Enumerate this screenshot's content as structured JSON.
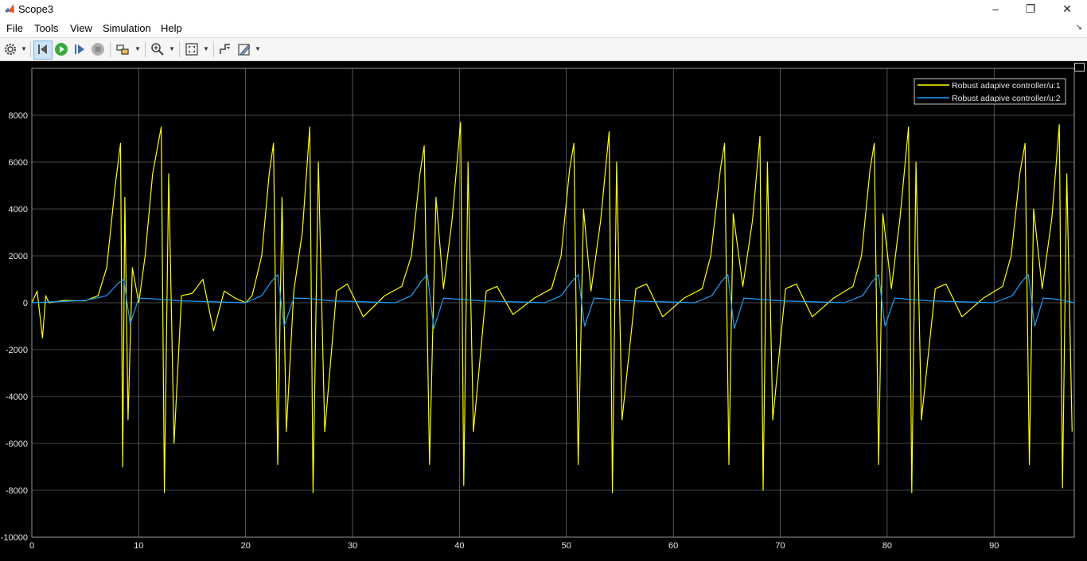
{
  "window": {
    "title": "Scope3",
    "minimize": "–",
    "maximize": "❐",
    "close": "✕"
  },
  "menu": {
    "items": [
      "File",
      "Tools",
      "View",
      "Simulation",
      "Help"
    ],
    "overflow_arrow": "↘"
  },
  "toolbar": {
    "icons": [
      "settings-icon",
      "step-back-icon",
      "run-icon",
      "step-forward-icon",
      "stop-icon",
      "highlight-icon",
      "zoom-icon",
      "autoscale-icon",
      "triggers-icon",
      "edit-icon"
    ]
  },
  "colors": {
    "series1": "#ffff00",
    "series2": "#1a9fff",
    "grid": "#8c8c8c",
    "background": "#000000"
  },
  "chart_data": {
    "type": "line",
    "title": "",
    "xlabel": "",
    "ylabel": "",
    "xlim": [
      0,
      97.5
    ],
    "ylim": [
      -10000,
      10000
    ],
    "x_ticks": [
      0,
      10,
      20,
      30,
      40,
      50,
      60,
      70,
      80,
      90
    ],
    "y_ticks": [
      -10000,
      -8000,
      -6000,
      -4000,
      -2000,
      0,
      2000,
      4000,
      6000,
      8000
    ],
    "grid": true,
    "legend_position": "top-right",
    "series": [
      {
        "name": "Robust adapive controller/u:1",
        "x": [
          0,
          0.5,
          1.0,
          1.3,
          1.6,
          3,
          5,
          6.2,
          7,
          7.8,
          8.3,
          8.5,
          8.7,
          9.0,
          9.4,
          10,
          10.6,
          11.3,
          12.1,
          12.4,
          12.8,
          13.3,
          14,
          15,
          16,
          17,
          18,
          19,
          20,
          20.6,
          21.5,
          22.2,
          22.6,
          23.0,
          23.4,
          23.8,
          24.5,
          25.3,
          26.0,
          26.3,
          26.8,
          27.4,
          28.5,
          29.5,
          31,
          33,
          34.6,
          35.5,
          36.3,
          36.7,
          37.2,
          37.8,
          38.5,
          39.3,
          40.1,
          40.4,
          40.8,
          41.3,
          42.5,
          43.5,
          45,
          47,
          48.6,
          49.5,
          50.3,
          50.7,
          51.1,
          51.6,
          52.3,
          53.2,
          54.0,
          54.3,
          54.7,
          55.2,
          56.5,
          57.5,
          59,
          61,
          62.7,
          63.5,
          64.4,
          64.8,
          65.2,
          65.6,
          66.5,
          67.4,
          68.1,
          68.4,
          68.8,
          69.3,
          70.5,
          71.5,
          73,
          75,
          76.8,
          77.6,
          78.4,
          78.8,
          79.2,
          79.6,
          80.4,
          81.2,
          82.0,
          82.3,
          82.7,
          83.2,
          84.5,
          85.5,
          87,
          89,
          90.8,
          91.6,
          92.4,
          92.9,
          93.3,
          93.7,
          94.5,
          95.4,
          96.1,
          96.4,
          96.8,
          97.3
        ],
        "y": [
          0,
          500,
          -1500,
          300,
          0,
          100,
          80,
          300,
          1500,
          5000,
          6800,
          -7000,
          4500,
          -5000,
          1500,
          0,
          2000,
          5500,
          7500,
          -8100,
          5500,
          -6000,
          300,
          400,
          1000,
          -1200,
          500,
          200,
          0,
          300,
          2000,
          5500,
          6800,
          -6900,
          4500,
          -5500,
          500,
          3000,
          7500,
          -8100,
          6000,
          -5500,
          500,
          800,
          -600,
          300,
          700,
          2000,
          5500,
          6700,
          -6900,
          4500,
          600,
          3500,
          7700,
          -7800,
          6000,
          -5500,
          500,
          700,
          -500,
          200,
          600,
          2000,
          5700,
          6800,
          -6900,
          4000,
          500,
          3500,
          7300,
          -8100,
          6000,
          -5000,
          600,
          800,
          -600,
          200,
          600,
          2000,
          5700,
          6800,
          -6900,
          3800,
          700,
          3500,
          7100,
          -8000,
          6000,
          -5000,
          600,
          800,
          -600,
          200,
          700,
          2000,
          5700,
          6800,
          -6900,
          3800,
          600,
          3600,
          7500,
          -8100,
          6000,
          -5000,
          600,
          800,
          -600,
          200,
          700,
          2000,
          5500,
          6800,
          -6900,
          4000,
          600,
          3600,
          7600,
          -7900,
          5500,
          -5500
        ]
      },
      {
        "name": "Robust adapive controller/u:2",
        "x": [
          0,
          5,
          7,
          8,
          8.6,
          9.2,
          10,
          12,
          14,
          20,
          21.5,
          22.4,
          23,
          23.6,
          24.5,
          26,
          28,
          34,
          35.5,
          36.4,
          37,
          37.6,
          38.5,
          40,
          42,
          48,
          49.5,
          50.5,
          51.1,
          51.7,
          52.6,
          54,
          56,
          62,
          63.6,
          64.5,
          65.1,
          65.7,
          66.6,
          68,
          70,
          76,
          77.7,
          78.6,
          79.2,
          79.8,
          80.7,
          82,
          84,
          90,
          91.7,
          92.6,
          93.2,
          93.8,
          94.6,
          96,
          97.5
        ],
        "y": [
          0,
          100,
          300,
          800,
          1000,
          -900,
          200,
          150,
          80,
          0,
          300,
          900,
          1200,
          -1000,
          200,
          180,
          80,
          0,
          300,
          900,
          1200,
          -1100,
          200,
          150,
          80,
          0,
          300,
          900,
          1200,
          -1000,
          200,
          150,
          80,
          0,
          300,
          900,
          1200,
          -1100,
          200,
          150,
          80,
          0,
          300,
          900,
          1200,
          -1000,
          200,
          150,
          80,
          0,
          300,
          900,
          1200,
          -1000,
          200,
          150,
          0
        ]
      }
    ]
  }
}
